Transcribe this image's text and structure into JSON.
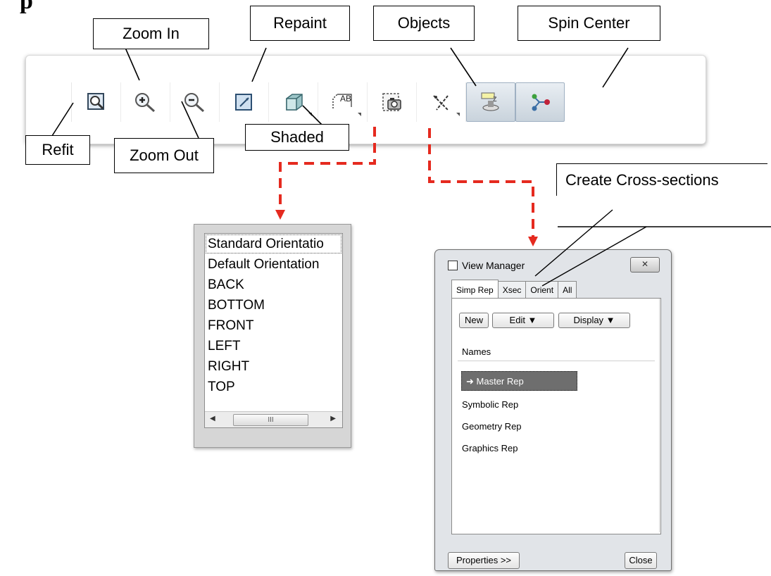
{
  "heading_fragment": "p",
  "callouts": {
    "zoom_in": "Zoom In",
    "repaint": "Repaint",
    "objects": "Objects",
    "spin_center": "Spin Center",
    "refit": "Refit",
    "zoom_out": "Zoom Out",
    "shaded": "Shaded",
    "create_cross_sections": "Create Cross-sections"
  },
  "toolbar": {
    "buttons": [
      {
        "icon": "refit-icon"
      },
      {
        "icon": "zoom-in-icon"
      },
      {
        "icon": "zoom-out-icon"
      },
      {
        "icon": "repaint-icon"
      },
      {
        "icon": "shaded-icon"
      },
      {
        "icon": "saved-views-icon"
      },
      {
        "icon": "view-manager-icon"
      },
      {
        "icon": "datum-display-icon"
      },
      {
        "icon": "spin-center-toggle-icon"
      },
      {
        "icon": "spin-center-icon"
      }
    ]
  },
  "orientation_list": {
    "items": [
      "Standard Orientatio",
      "Default Orientation",
      "BACK",
      "BOTTOM",
      "FRONT",
      "LEFT",
      "RIGHT",
      "TOP"
    ],
    "scroll_thumb": "III"
  },
  "view_manager": {
    "title": "View Manager",
    "tabs": [
      "Simp Rep",
      "Xsec",
      "Orient",
      "All"
    ],
    "new_label": "New",
    "edit_label": "Edit ▼",
    "display_label": "Display ▼",
    "names_header": "Names",
    "rows": [
      "Master Rep",
      "Symbolic Rep",
      "Geometry Rep",
      "Graphics Rep"
    ],
    "properties_label": "Properties >>",
    "close_label": "Close"
  },
  "colors": {
    "connector_red": "#e52a1f",
    "selected_row": "#6e6e6e"
  }
}
